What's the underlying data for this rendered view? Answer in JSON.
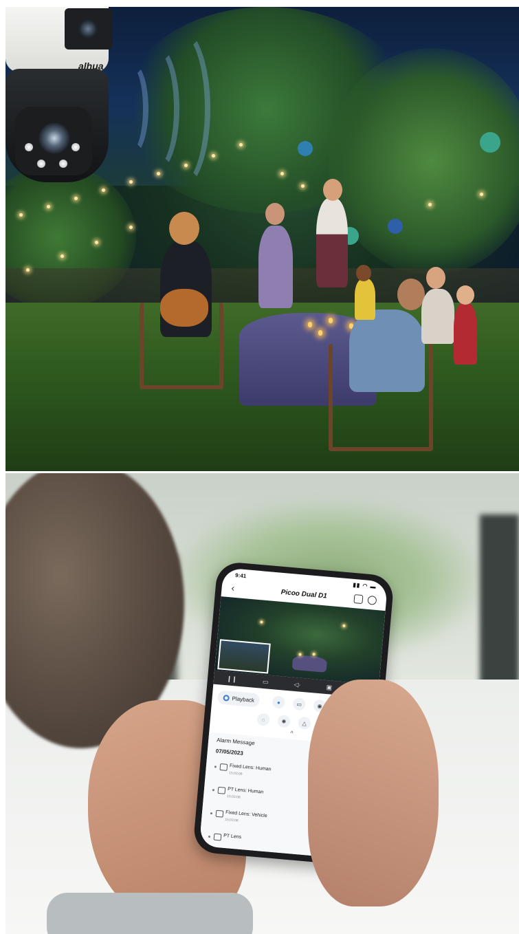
{
  "camera": {
    "brand": "alhua"
  },
  "app": {
    "status_time": "9:41",
    "device_title": "Picoo Dual D1",
    "playback_label": "Playback",
    "alarm_panel": {
      "title": "Alarm Message",
      "date": "07/05/2023",
      "items": [
        {
          "label": "Fixed Lens: Human",
          "time": "15:03:06"
        },
        {
          "label": "PT Lens: Human",
          "time": "15:03:06"
        },
        {
          "label": "Fixed Lens: Vehicle",
          "time": "15:03:06"
        },
        {
          "label": "PT Lens",
          "time": ""
        }
      ]
    }
  }
}
